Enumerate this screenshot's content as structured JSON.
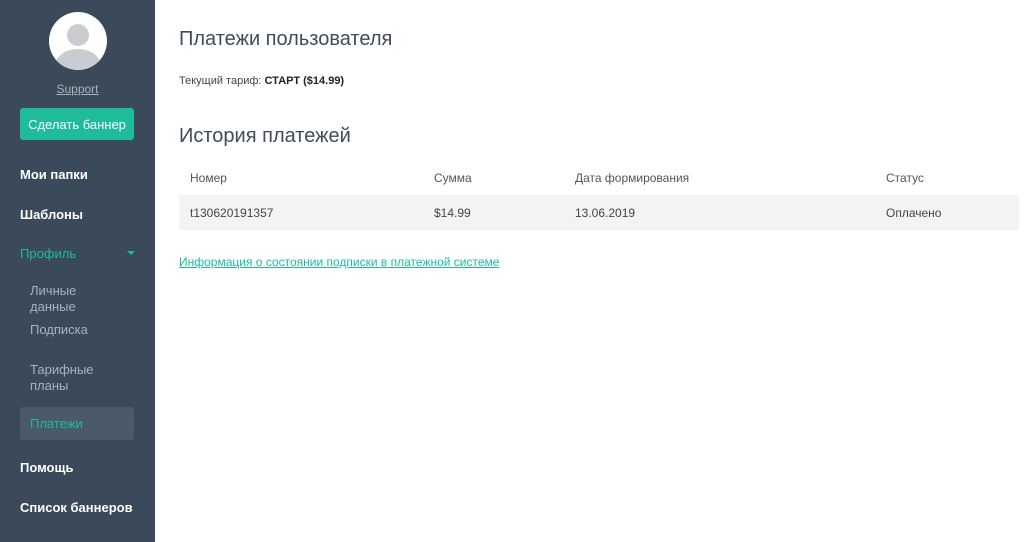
{
  "sidebar": {
    "username": "Support",
    "make_banner_label": "Сделать баннер",
    "nav": {
      "folders": "Мои папки",
      "templates": "Шаблоны",
      "profile": "Профиль",
      "profile_items": {
        "personal": "Личные данные",
        "subscription": "Подписка",
        "tariffs": "Тарифные планы",
        "payments": "Платежи"
      },
      "help": "Помощь",
      "banner_list": "Список баннеров"
    },
    "colors": {
      "background": "#3a4a5a",
      "accent": "#1fbc9c"
    }
  },
  "main": {
    "page_title": "Платежи пользователя",
    "tariff_label": "Текущий тариф:",
    "tariff_value": "СТАРТ ($14.99)",
    "history_title": "История платежей",
    "table": {
      "headers": {
        "number": "Номер",
        "amount": "Сумма",
        "date": "Дата формирования",
        "status": "Статус"
      },
      "rows": [
        {
          "number": "t130620191357",
          "amount": "$14.99",
          "date": "13.06.2019",
          "status": "Оплачено"
        }
      ]
    },
    "subscription_link": "Информация о состоянии подписки в платежной системе"
  }
}
